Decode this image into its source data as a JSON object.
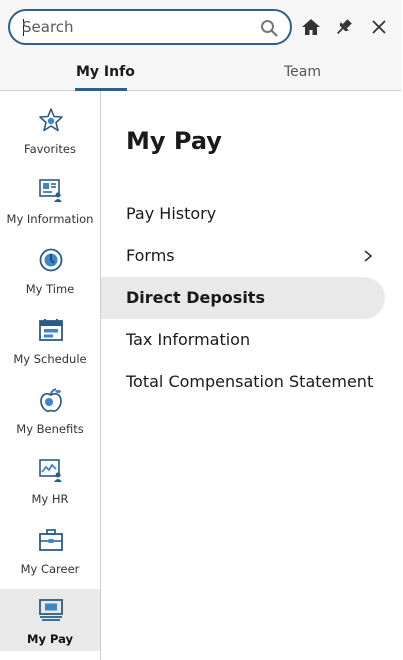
{
  "search": {
    "placeholder": "Search",
    "value": ""
  },
  "tabs": [
    {
      "label": "My Info",
      "active": true
    },
    {
      "label": "Team",
      "active": false
    }
  ],
  "nav": [
    {
      "label": "Favorites",
      "icon": "star-icon",
      "selected": false
    },
    {
      "label": "My Information",
      "icon": "id-card-icon",
      "selected": false
    },
    {
      "label": "My Time",
      "icon": "clock-icon",
      "selected": false
    },
    {
      "label": "My Schedule",
      "icon": "calendar-icon",
      "selected": false
    },
    {
      "label": "My Benefits",
      "icon": "apple-icon",
      "selected": false
    },
    {
      "label": "My HR",
      "icon": "hr-profile-icon",
      "selected": false
    },
    {
      "label": "My Career",
      "icon": "briefcase-icon",
      "selected": false
    },
    {
      "label": "My Pay",
      "icon": "paycheck-icon",
      "selected": true
    }
  ],
  "main": {
    "title": "My Pay",
    "items": [
      {
        "label": "Pay History",
        "has_submenu": false,
        "selected": false
      },
      {
        "label": "Forms",
        "has_submenu": true,
        "selected": false
      },
      {
        "label": "Direct Deposits",
        "has_submenu": false,
        "selected": true
      },
      {
        "label": "Tax Information",
        "has_submenu": false,
        "selected": false
      },
      {
        "label": "Total Compensation Statement",
        "has_submenu": false,
        "selected": false
      }
    ]
  },
  "colors": {
    "accent": "#2f5f8a",
    "icon_fill": "#3c87c8",
    "selected_bg": "#e9e9e9"
  }
}
